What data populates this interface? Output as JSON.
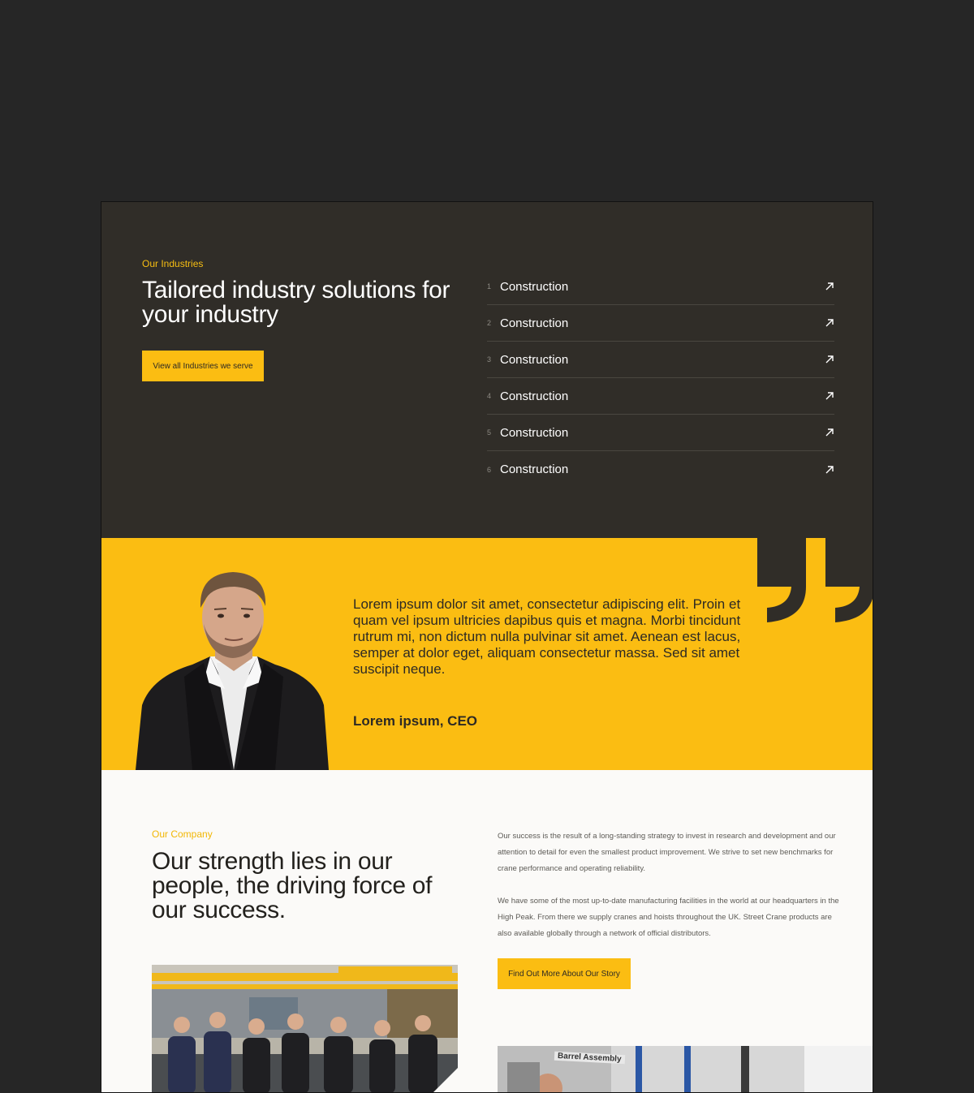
{
  "industries": {
    "eyebrow": "Our Industries",
    "title": "Tailored industry solutions for your industry",
    "button_label": "View all Industries we serve",
    "items": [
      {
        "number": "1",
        "label": "Construction"
      },
      {
        "number": "2",
        "label": "Construction"
      },
      {
        "number": "3",
        "label": "Construction"
      },
      {
        "number": "4",
        "label": "Construction"
      },
      {
        "number": "5",
        "label": "Construction"
      },
      {
        "number": "6",
        "label": "Construction"
      }
    ],
    "arrow_icon": "arrow-up-right-icon"
  },
  "testimonial": {
    "quote": "Lorem ipsum dolor sit amet, consectetur adipiscing elit. Proin et quam vel ipsum ultricies dapibus quis et magna. Morbi tincidunt rutrum mi, non dictum nulla pulvinar sit amet. Aenean est lacus, semper at dolor eget, aliquam consectetur massa. Sed sit amet suscipit neque.",
    "author": "Lorem ipsum, CEO",
    "quote_icon": "closing-quote-icon"
  },
  "company": {
    "eyebrow": "Our Company",
    "title": "Our strength lies in our people, the driving force of our success.",
    "paragraph_1": "Our success is the result of a long-standing strategy to invest in research and development and our attention to detail for even the smallest product improvement. We strive to set new benchmarks for crane performance and operating reliability.",
    "paragraph_2": "We have some of the most up-to-date manufacturing facilities in the world at our headquarters in the High Peak. From there we supply cranes and hoists throughout the UK. Street Crane products are also available globally through a network of official distributors.",
    "button_label": "Find Out More About Our Story",
    "photo_sign": "Barrel Assembly"
  },
  "colors": {
    "page_bg": "#262626",
    "dark_section": "#302d28",
    "accent_yellow": "#fbbd12",
    "light_section": "#fbfaf8",
    "text_dark": "#2d2a24"
  }
}
